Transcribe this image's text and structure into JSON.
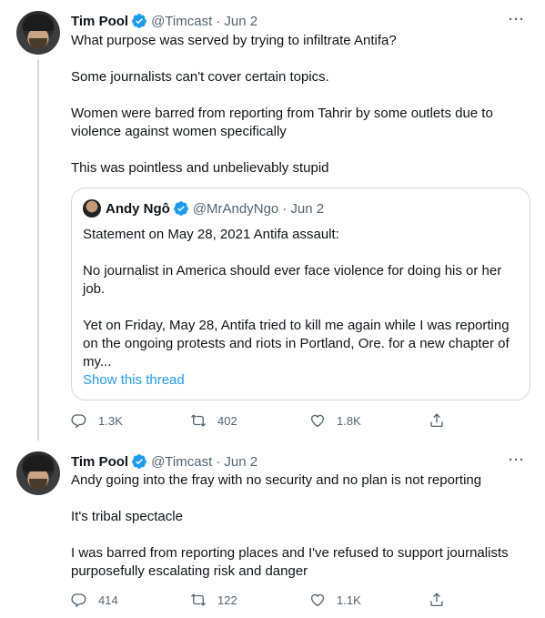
{
  "tweets": [
    {
      "name": "Tim Pool",
      "handle": "@Timcast",
      "date": "· Jun 2",
      "more": "···",
      "paragraphs": [
        "What purpose was served by trying to infiltrate Antifa?",
        "Some journalists can't cover certain topics.",
        "Women were barred from reporting from Tahrir by some outlets due to violence against women specifically",
        "This was pointless and unbelievably stupid"
      ],
      "quote": {
        "name": "Andy Ngô",
        "handle": "@MrAndyNgo",
        "date": "· Jun 2",
        "paragraphs": [
          "Statement on May 28, 2021 Antifa assault:",
          "No journalist in America should ever face violence for doing his or her job.",
          "Yet on Friday, May 28, Antifa tried to kill me again while I was reporting on the ongoing protests and riots in Portland, Ore. for a new chapter of my..."
        ],
        "show_thread": "Show this thread"
      },
      "stats": {
        "replies": "1.3K",
        "retweets": "402",
        "likes": "1.8K"
      }
    },
    {
      "name": "Tim Pool",
      "handle": "@Timcast",
      "date": "· Jun 2",
      "more": "···",
      "paragraphs": [
        "Andy going into the fray with no security and no plan is not reporting",
        "It's tribal spectacle",
        "I was barred from reporting places and I've refused to support journalists purposefully escalating risk and danger"
      ],
      "stats": {
        "replies": "414",
        "retweets": "122",
        "likes": "1.1K"
      }
    }
  ],
  "colors": {
    "accent": "#1d9bf0",
    "text": "#0f1419",
    "muted": "#536471",
    "border": "#cfd9de"
  },
  "icons": [
    "verified-badge-icon",
    "reply-icon",
    "retweet-icon",
    "like-icon",
    "share-icon",
    "more-icon"
  ]
}
